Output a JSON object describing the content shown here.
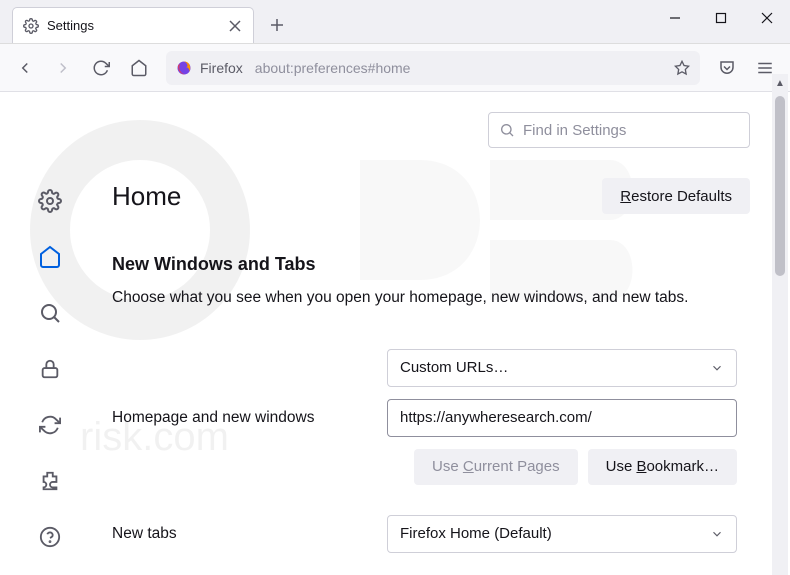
{
  "window": {
    "tab_title": "Settings",
    "url_brand": "Firefox",
    "url_addr": "about:preferences#home"
  },
  "search": {
    "placeholder": "Find in Settings"
  },
  "page": {
    "title": "Home",
    "restore_label": "Restore Defaults",
    "restore_u": "R"
  },
  "section": {
    "heading": "New Windows and Tabs",
    "desc": "Choose what you see when you open your homepage, new windows, and new tabs."
  },
  "homepage": {
    "label": "Homepage and new windows",
    "dropdown": "Custom URLs…",
    "url_value": "https://anywheresearch.com/",
    "use_current": "Use Current Pages",
    "use_current_u": "C",
    "use_bookmark": "Use Bookmark…",
    "use_bookmark_u": "B"
  },
  "newtabs": {
    "label": "New tabs",
    "dropdown": "Firefox Home (Default)"
  }
}
